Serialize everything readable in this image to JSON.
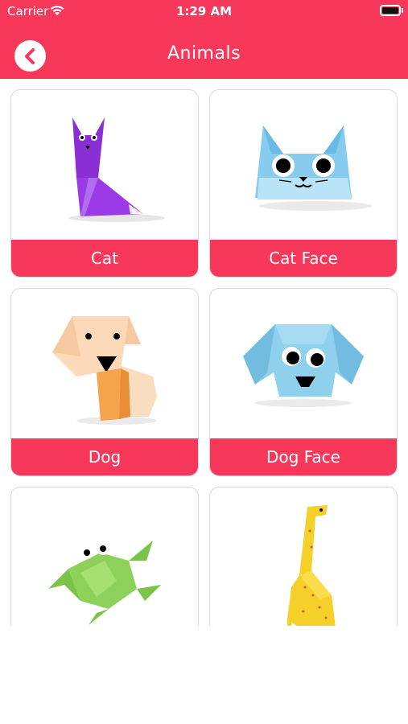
{
  "status_bar": {
    "carrier": "Carrier",
    "time": "1:29 AM"
  },
  "header": {
    "title": "Animals",
    "back_icon": "chevron-left-icon",
    "color": "#F7385A"
  },
  "animals": [
    {
      "label": "Cat",
      "icon": "origami-cat-icon"
    },
    {
      "label": "Cat Face",
      "icon": "origami-cat-face-icon"
    },
    {
      "label": "Dog",
      "icon": "origami-dog-icon"
    },
    {
      "label": "Dog Face",
      "icon": "origami-dog-face-icon"
    },
    {
      "label": "",
      "icon": "origami-frog-icon"
    },
    {
      "label": "",
      "icon": "origami-giraffe-icon"
    }
  ]
}
